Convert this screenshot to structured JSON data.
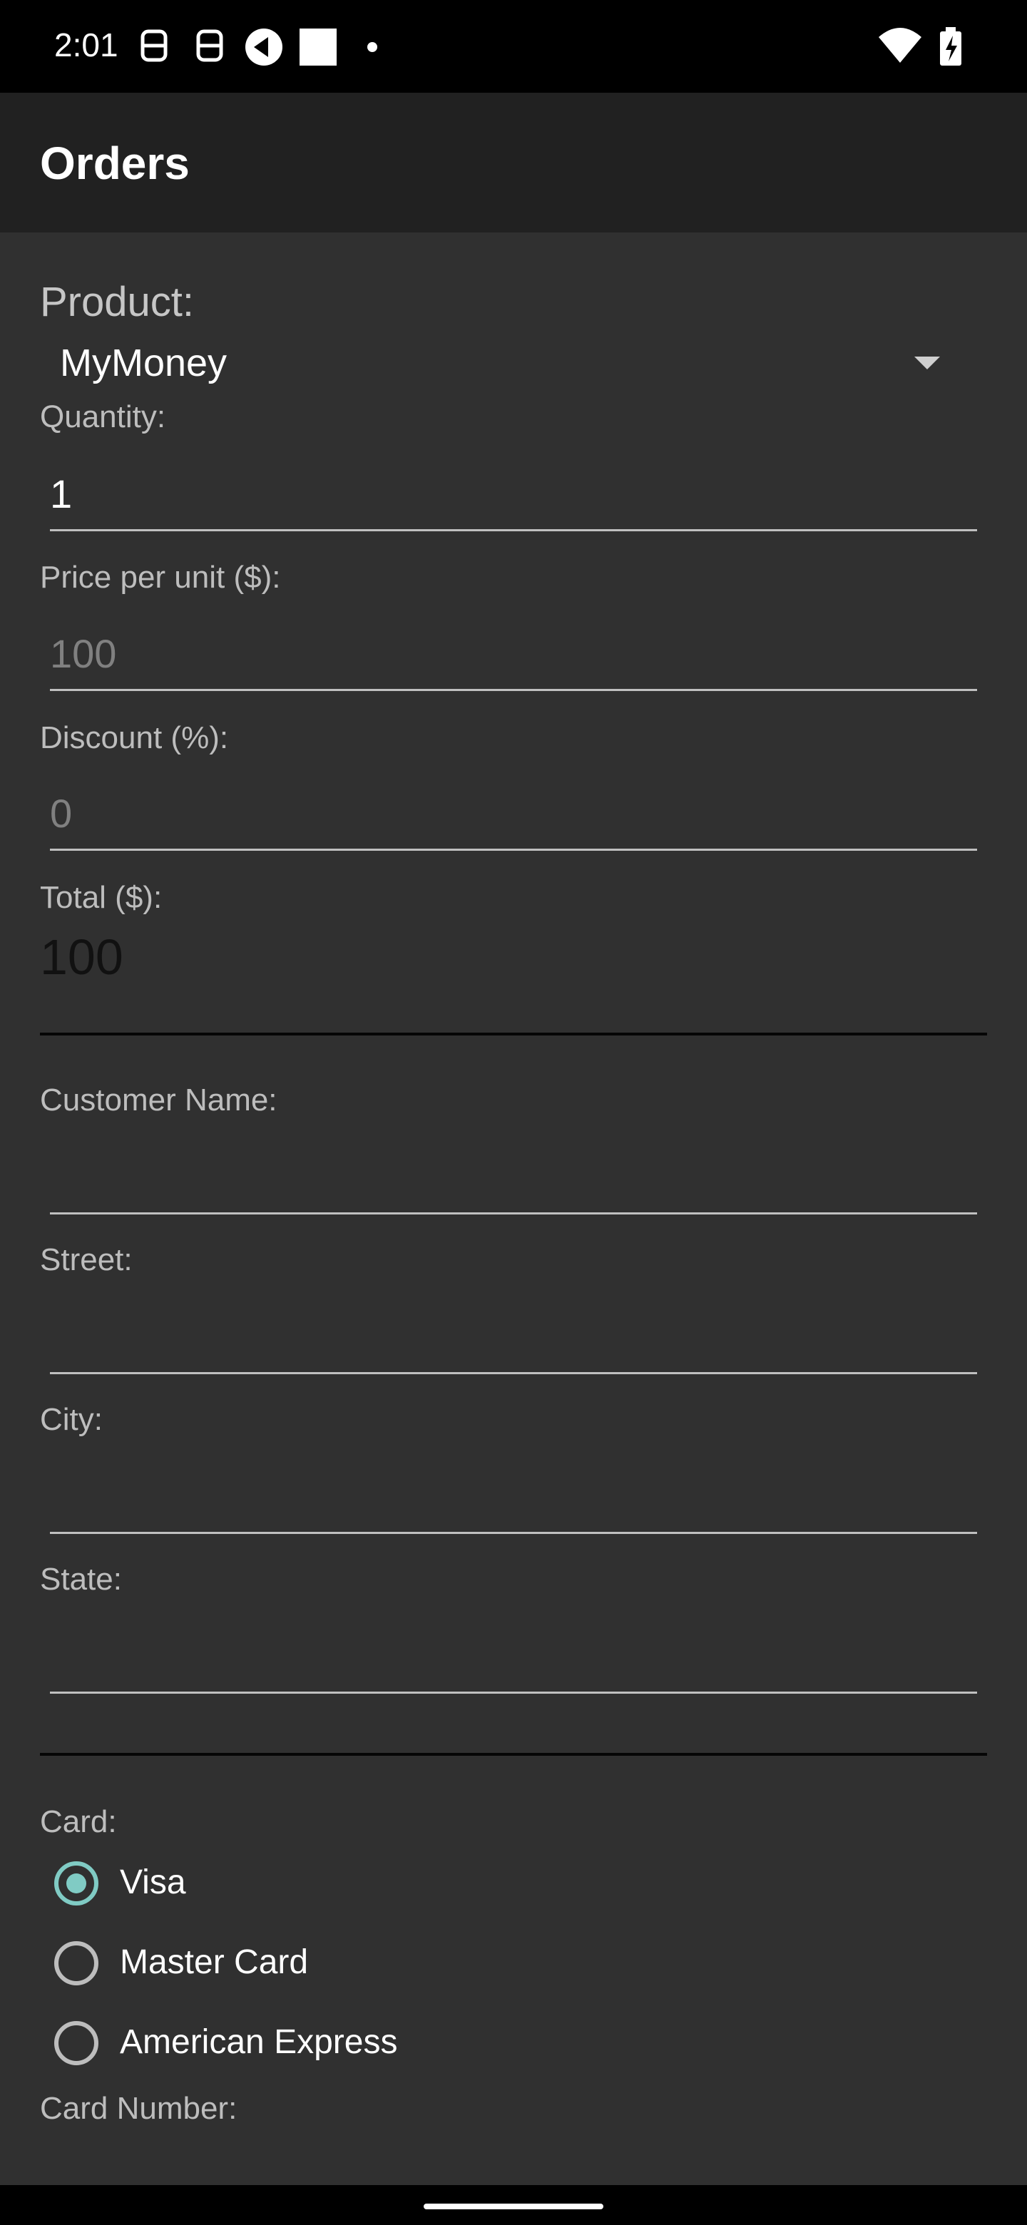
{
  "status_bar": {
    "time": "2:01",
    "left_icons": [
      "notification-s-icon",
      "notification-s-icon",
      "notification-app-icon",
      "notification-square-icon",
      "dot-icon"
    ],
    "right_icons": [
      "wifi-icon",
      "battery-charging-icon"
    ]
  },
  "app_bar": {
    "title": "Orders"
  },
  "form": {
    "product": {
      "label": "Product:",
      "selected": "MyMoney"
    },
    "quantity": {
      "label": "Quantity:",
      "value": "1"
    },
    "price": {
      "label": "Price per unit ($):",
      "placeholder": "100"
    },
    "discount": {
      "label": "Discount (%):",
      "placeholder": "0"
    },
    "total": {
      "label": "Total ($):",
      "value": "100"
    },
    "customer_name": {
      "label": "Customer Name:",
      "value": ""
    },
    "street": {
      "label": "Street:",
      "value": ""
    },
    "city": {
      "label": "City:",
      "value": ""
    },
    "state": {
      "label": "State:",
      "value": ""
    },
    "card": {
      "label": "Card:",
      "options": [
        "Visa",
        "Master Card",
        "American Express"
      ],
      "selected": "Visa"
    },
    "card_number": {
      "label": "Card Number:"
    }
  },
  "colors": {
    "background": "#303030",
    "app_bar": "#212121",
    "accent": "#80cbc4",
    "status_bar": "#000000"
  }
}
